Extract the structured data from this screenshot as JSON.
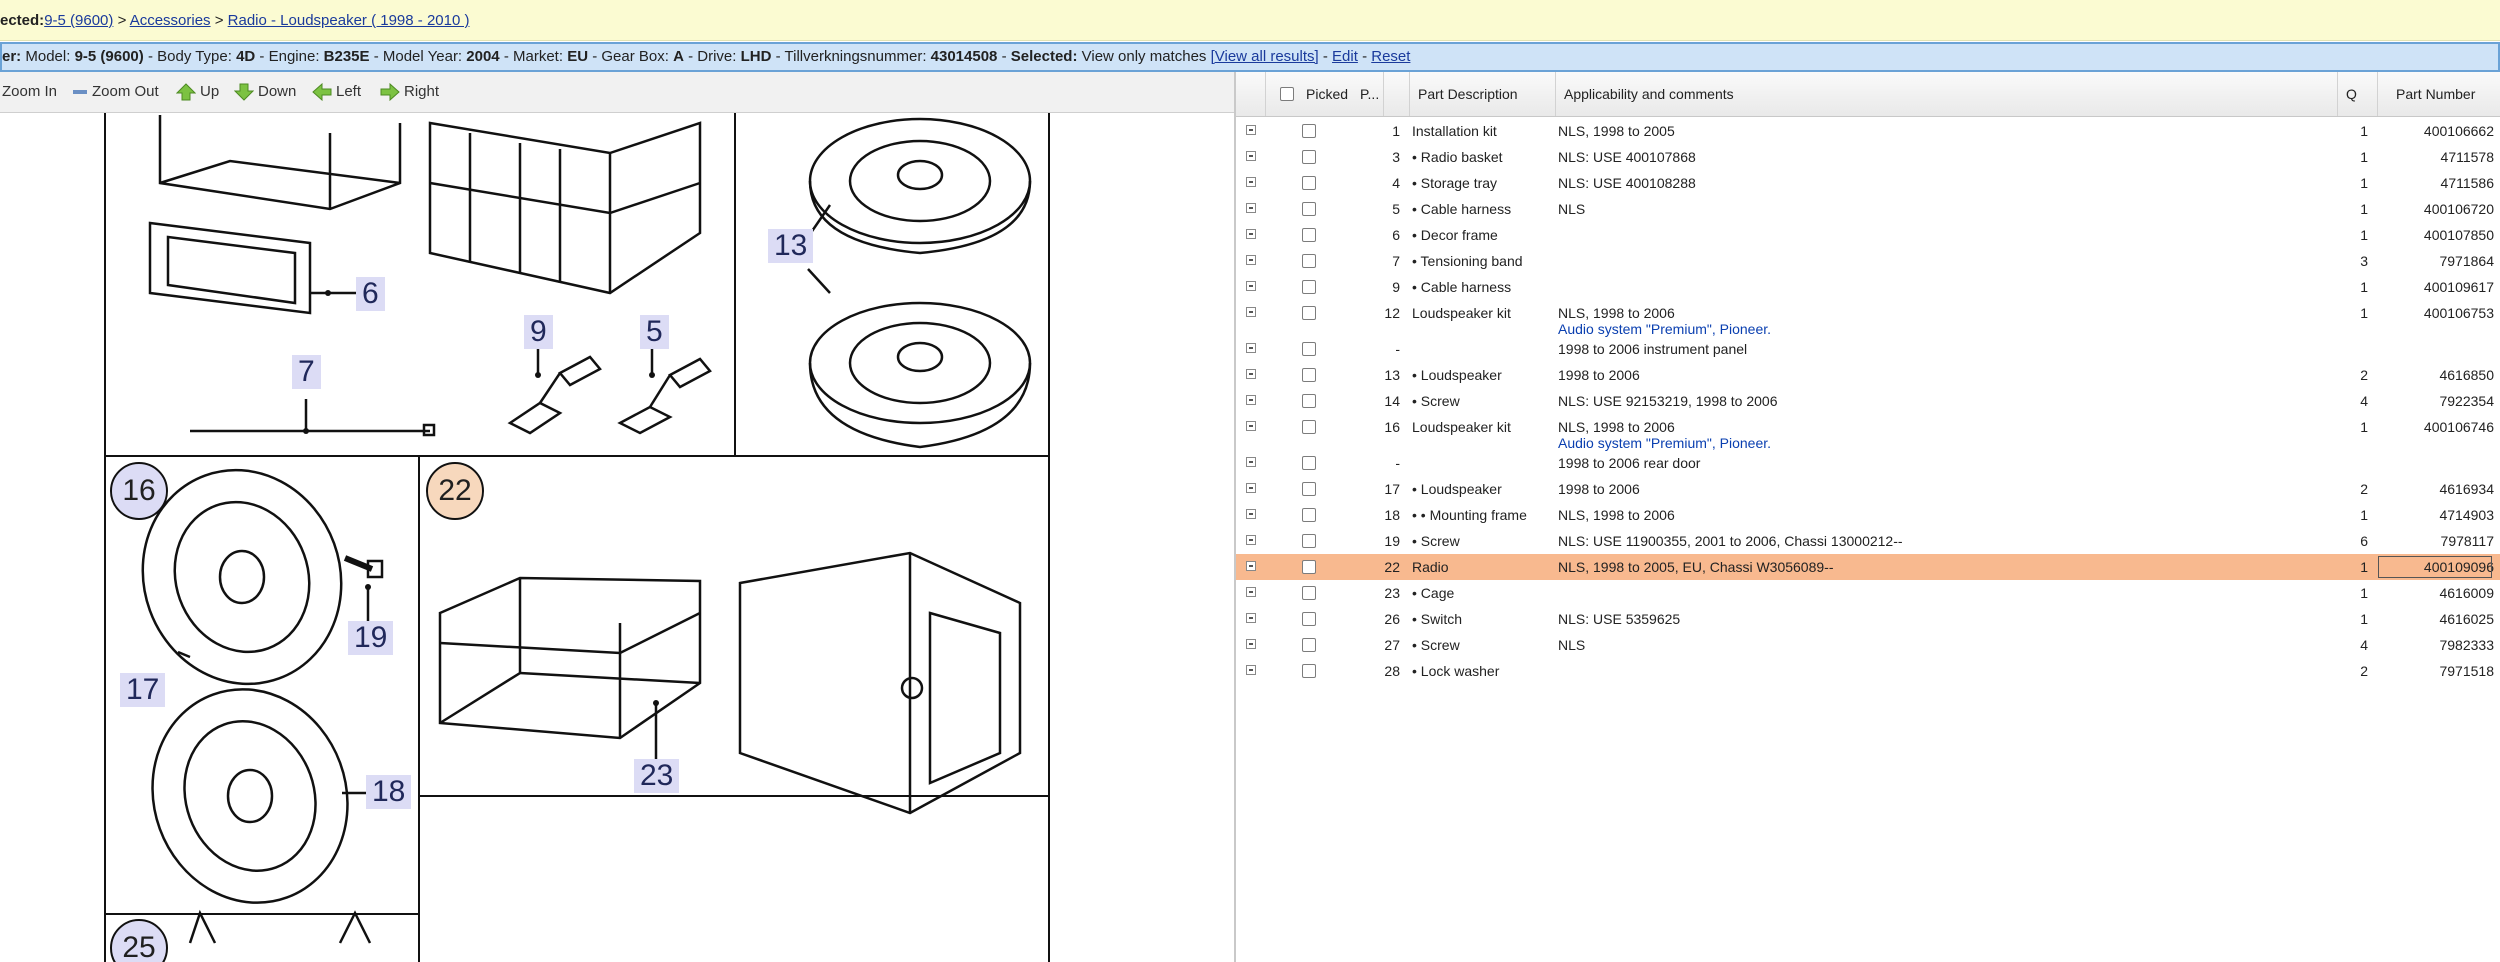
{
  "breadcrumb": {
    "prefix": "ected:",
    "links": [
      "9-5 (9600)",
      "Accessories",
      "Radio - Loudspeaker ( 1998 - 2010 )"
    ],
    "sep": " > "
  },
  "filter": {
    "lead": "er:",
    "model_label": "Model:",
    "model_value": "9-5 (9600)",
    "body_label": "Body Type:",
    "body_value": "4D",
    "engine_label": "Engine:",
    "engine_value": "B235E",
    "year_label": "Model Year:",
    "year_value": "2004",
    "market_label": "Market:",
    "market_value": "EU",
    "gear_label": "Gear Box:",
    "gear_value": "A",
    "drive_label": "Drive:",
    "drive_value": "LHD",
    "till_label": "Tillverkningsnummer:",
    "till_value": "43014508",
    "selected_label": "Selected:",
    "selected_value": "View only matches",
    "view_all": "[View all results]",
    "edit": "Edit",
    "reset": "Reset"
  },
  "toolbar": {
    "zoom_in": "Zoom In",
    "zoom_out": "Zoom Out",
    "up": "Up",
    "down": "Down",
    "left": "Left",
    "right": "Right"
  },
  "diagram": {
    "callouts": [
      "13",
      "6",
      "9",
      "5",
      "7",
      "19",
      "17",
      "18",
      "23"
    ],
    "circles": [
      "16",
      "22",
      "25"
    ]
  },
  "table": {
    "headers": {
      "picked": "Picked",
      "pos": "P...",
      "desc": "Part Description",
      "appl": "Applicability and comments",
      "qty": "Q",
      "part": "Part Number"
    },
    "rows": [
      {
        "pos": "1",
        "desc": "Installation kit",
        "appl": "NLS, 1998 to 2005",
        "qty": "1",
        "part": "400106662"
      },
      {
        "pos": "3",
        "desc": "• Radio basket",
        "appl": "NLS: USE 400107868",
        "qty": "1",
        "part": "4711578"
      },
      {
        "pos": "4",
        "desc": "• Storage tray",
        "appl": "NLS: USE 400108288",
        "qty": "1",
        "part": "4711586"
      },
      {
        "pos": "5",
        "desc": "• Cable harness",
        "appl": "NLS",
        "qty": "1",
        "part": "400106720"
      },
      {
        "pos": "6",
        "desc": "• Decor frame",
        "appl": "",
        "qty": "1",
        "part": "400107850"
      },
      {
        "pos": "7",
        "desc": "• Tensioning band",
        "appl": "",
        "qty": "3",
        "part": "7971864"
      },
      {
        "pos": "9",
        "desc": "• Cable harness",
        "appl": "",
        "qty": "1",
        "part": "400109617"
      },
      {
        "pos": "12",
        "desc": "Loudspeaker kit",
        "appl": "NLS, 1998 to 2006",
        "appl2": "Audio system \"Premium\", Pioneer.",
        "qty": "1",
        "part": "400106753"
      },
      {
        "pos": "-",
        "desc": "",
        "appl": "1998 to 2006 instrument panel",
        "qty": "",
        "part": ""
      },
      {
        "pos": "13",
        "desc": "• Loudspeaker",
        "appl": "1998 to 2006",
        "qty": "2",
        "part": "4616850"
      },
      {
        "pos": "14",
        "desc": "• Screw",
        "appl": "NLS: USE 92153219, 1998 to 2006",
        "qty": "4",
        "part": "7922354"
      },
      {
        "pos": "16",
        "desc": "Loudspeaker kit",
        "appl": "NLS, 1998 to 2006",
        "appl2": "Audio system \"Premium\", Pioneer.",
        "qty": "1",
        "part": "400106746"
      },
      {
        "pos": "-",
        "desc": "",
        "appl": "1998 to 2006 rear door",
        "qty": "",
        "part": ""
      },
      {
        "pos": "17",
        "desc": "• Loudspeaker",
        "appl": "1998 to 2006",
        "qty": "2",
        "part": "4616934"
      },
      {
        "pos": "18",
        "desc": "• • Mounting frame",
        "appl": "NLS, 1998 to 2006",
        "qty": "1",
        "part": "4714903"
      },
      {
        "pos": "19",
        "desc": "• Screw",
        "appl": "NLS: USE 11900355, 2001 to 2006, Chassi 13000212--",
        "qty": "6",
        "part": "7978117"
      },
      {
        "pos": "22",
        "desc": "Radio",
        "appl": "NLS, 1998 to 2005, EU, Chassi W3056089--",
        "qty": "1",
        "part": "400109096",
        "selected": true
      },
      {
        "pos": "23",
        "desc": "• Cage",
        "appl": "",
        "qty": "1",
        "part": "4616009"
      },
      {
        "pos": "26",
        "desc": "• Switch",
        "appl": "NLS: USE 5359625",
        "qty": "1",
        "part": "4616025"
      },
      {
        "pos": "27",
        "desc": "• Screw",
        "appl": "NLS",
        "qty": "4",
        "part": "7982333"
      },
      {
        "pos": "28",
        "desc": "• Lock washer",
        "appl": "",
        "qty": "2",
        "part": "7971518"
      }
    ]
  },
  "colors": {
    "selected_row": "#f8b98f",
    "filter_bg": "#cfe3f7",
    "crumb_bg": "#fbfbd2",
    "link": "#1a3a9c"
  }
}
